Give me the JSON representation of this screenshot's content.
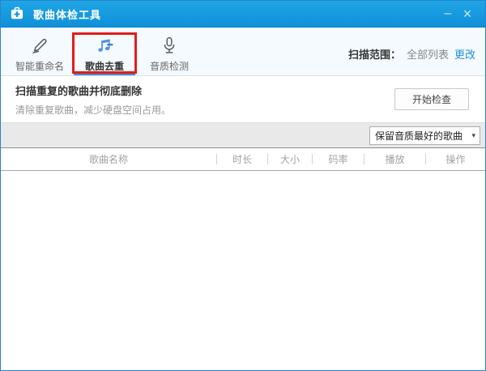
{
  "window": {
    "title": "歌曲体检工具",
    "minimize_label": "–",
    "close_label": "×"
  },
  "toolbar": {
    "tabs": [
      {
        "label": "智能重命名",
        "icon": "pencil-icon",
        "active": false,
        "highlighted": false
      },
      {
        "label": "歌曲去重",
        "icon": "music-note-icon",
        "active": true,
        "highlighted": true
      },
      {
        "label": "音质检测",
        "icon": "microphone-icon",
        "active": false,
        "highlighted": false
      }
    ],
    "scan_scope_label": "扫描范围：",
    "scan_scope_value": "全部列表",
    "change_link": "更改"
  },
  "scan_section": {
    "title": "扫描重复的歌曲并彻底删除",
    "subtitle": "清除重复歌曲，减少硬盘空间占用。",
    "start_button": "开始检查"
  },
  "options_bar": {
    "keep_dropdown_value": "保留音质最好的歌曲",
    "chevron_glyph": "▾"
  },
  "table": {
    "columns": [
      "歌曲名称",
      "时长",
      "大小",
      "码率",
      "播放",
      "操作"
    ],
    "rows": []
  },
  "icons": {
    "app": "first-aid-kit-icon",
    "tab_rename": "pencil-icon",
    "tab_dedup": "music-note-icon",
    "tab_quality": "microphone-icon",
    "dropdown": "chevron-down-icon"
  },
  "colors": {
    "titlebar_blue": "#1297dc",
    "window_border_blue": "#2a82c8",
    "highlight_red": "#e11c1c",
    "active_underline_blue": "#4090d8",
    "link_blue": "#1f8fd8",
    "strip_gray": "#e9e9e9"
  }
}
